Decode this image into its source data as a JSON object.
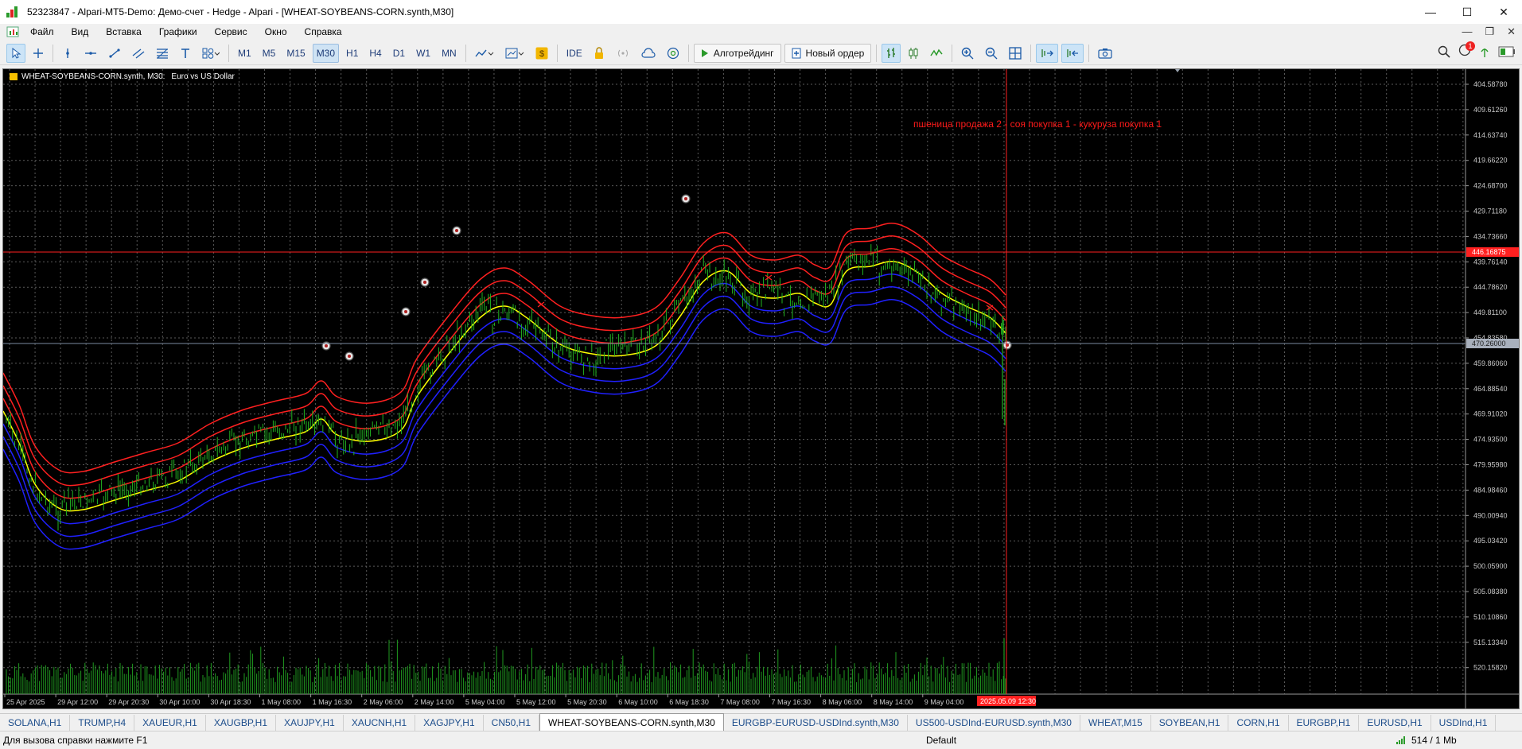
{
  "window": {
    "title": "52323847 - Alpari-MT5-Demo: Демо-счет - Hedge - Alpari - [WHEAT-SOYBEANS-CORN.synth,M30]",
    "controls": [
      "—",
      "☐",
      "✕"
    ]
  },
  "menu": {
    "items": [
      "Файл",
      "Вид",
      "Вставка",
      "Графики",
      "Сервис",
      "Окно",
      "Справка"
    ],
    "right_controls": [
      "—",
      "❐",
      "✕"
    ]
  },
  "toolbar": {
    "timeframes": [
      "M1",
      "M5",
      "M15",
      "M30",
      "H1",
      "H4",
      "D1",
      "W1",
      "MN"
    ],
    "active_timeframe": "M30",
    "ide_label": "IDE",
    "algotrading_label": "Алготрейдинг",
    "new_order_label": "Новый ордер",
    "notification_count": "1"
  },
  "chart": {
    "symbol_label": "WHEAT-SOYBEANS-CORN.synth, M30:",
    "description": "Euro vs US Dollar",
    "annotation": "пшеница продажа 2 - соя покупка 1 - кукуруза покупка 1",
    "price_labels": [
      "404.58780",
      "409.61260",
      "414.63740",
      "419.66220",
      "424.68700",
      "429.71180",
      "434.73660",
      "439.76140",
      "444.78620",
      "449.81100",
      "454.83580",
      "459.86060",
      "464.88540",
      "469.91020",
      "474.93500",
      "479.95980",
      "484.98460",
      "490.00940",
      "495.03420",
      "500.05900",
      "505.08380",
      "510.10860",
      "515.13340",
      "520.15820"
    ],
    "current_price_label": "446.16875",
    "crosshair_price_label": "470.26000",
    "time_labels": [
      "25 Apr 2025",
      "29 Apr 12:00",
      "29 Apr 20:30",
      "30 Apr 10:00",
      "30 Apr 18:30",
      "1 May 08:00",
      "1 May 16:30",
      "2 May 06:00",
      "2 May 14:00",
      "5 May 04:00",
      "5 May 12:00",
      "5 May 20:30",
      "6 May 10:00",
      "6 May 18:30",
      "7 May 08:00",
      "7 May 16:30",
      "8 May 06:00",
      "8 May 14:00",
      "9 May 04:00"
    ],
    "crosshair_time_label": "2025.05.09 12:30",
    "colors": {
      "background": "#000000",
      "grid": "#5a5a5a",
      "candles": "#22b422",
      "volumes": "#1f9a1f",
      "band_upper": "#ff2020",
      "band_mid": "#ffff00",
      "band_lower": "#2020ff",
      "price_line": "#ff2020",
      "crosshair_h": "#7a8aa0",
      "annotation": "#ff1a1a"
    }
  },
  "tabs": {
    "items": [
      "SOLANA,H1",
      "TRUMP,H4",
      "XAUEUR,H1",
      "XAUGBP,H1",
      "XAUJPY,H1",
      "XAUCNH,H1",
      "XAGJPY,H1",
      "CN50,H1",
      "WHEAT-SOYBEANS-CORN.synth,M30",
      "EURGBP-EURUSD-USDInd.synth,M30",
      "US500-USDInd-EURUSD.synth,M30",
      "WHEAT,M15",
      "SOYBEAN,H1",
      "CORN,H1",
      "EURGBP,H1",
      "EURUSD,H1",
      "USDInd,H1"
    ],
    "active_index": 8
  },
  "status": {
    "help": "Для вызова справки нажмите F1",
    "profile": "Default",
    "connection": "514 / 1 Mb"
  }
}
